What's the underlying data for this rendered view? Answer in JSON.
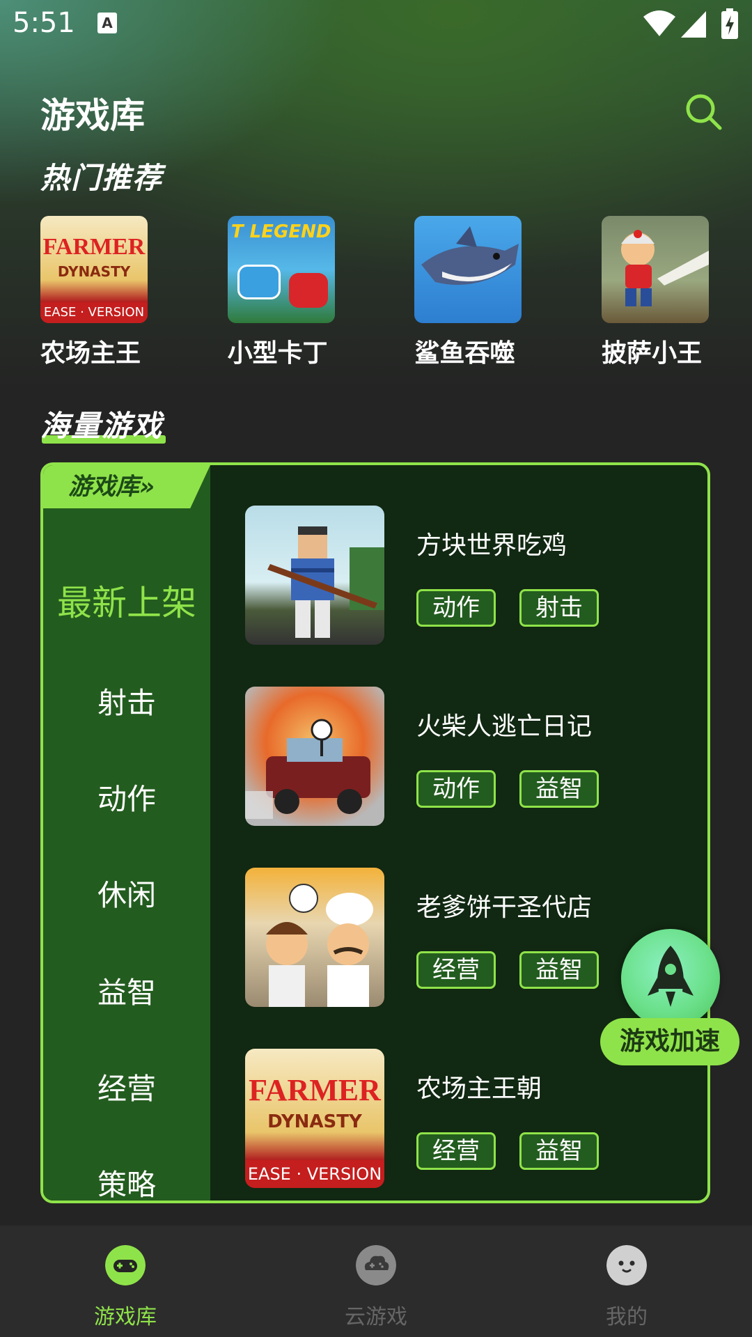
{
  "status_bar": {
    "time": "5:51",
    "notification": "A"
  },
  "header": {
    "title": "游戏库"
  },
  "sections": {
    "hot": "热门推荐",
    "mass": "海量游戏"
  },
  "hot_games": [
    {
      "name": "农场主王",
      "thumb_text": "FARMER",
      "thumb_sub": "DYNASTY",
      "thumb_foot": "EASE · VERSION"
    },
    {
      "name": "小型卡丁",
      "thumb_text": "T LEGEND"
    },
    {
      "name": "鲨鱼吞噬"
    },
    {
      "name": "披萨小王"
    }
  ],
  "library_panel": {
    "tab_label": "游戏库»",
    "categories": [
      "最新上架",
      "射击",
      "动作",
      "休闲",
      "益智",
      "经营",
      "策略"
    ],
    "active_category": "最新上架",
    "games": [
      {
        "name": "方块世界吃鸡",
        "tags": [
          "动作",
          "射击"
        ]
      },
      {
        "name": "火柴人逃亡日记",
        "tags": [
          "动作",
          "益智"
        ]
      },
      {
        "name": "老爹饼干圣代店",
        "tags": [
          "经营",
          "益智"
        ]
      },
      {
        "name": "农场主王朝",
        "tags": [
          "经营",
          "益智"
        ],
        "thumb_text": "FARMER",
        "thumb_sub": "DYNASTY",
        "thumb_foot": "EASE · VERSION"
      }
    ]
  },
  "boost": {
    "label": "游戏加速"
  },
  "bottom_nav": [
    {
      "label": "游戏库",
      "icon": "gamepad-icon",
      "active": true
    },
    {
      "label": "云游戏",
      "icon": "cloud-game-icon",
      "active": false
    },
    {
      "label": "我的",
      "icon": "profile-icon",
      "active": false
    }
  ],
  "colors": {
    "accent": "#8fe34a",
    "panel_bg": "#112812",
    "side_bg": "#235c1f",
    "page_bg": "#242424"
  }
}
